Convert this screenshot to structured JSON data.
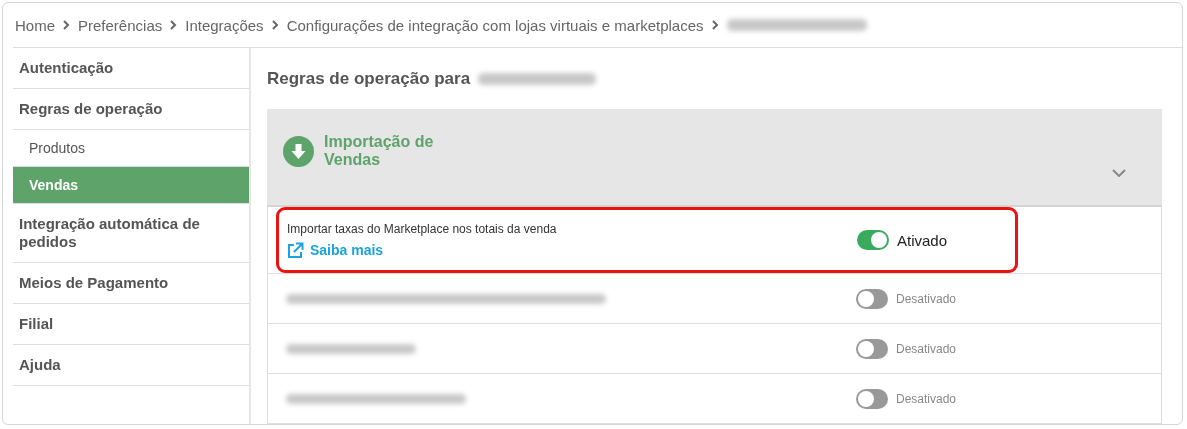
{
  "breadcrumb": {
    "items": [
      "Home",
      "Preferências",
      "Integrações",
      "Configurações de integração com lojas virtuais e marketplaces"
    ],
    "tail_redacted": true
  },
  "sidebar": {
    "items": [
      {
        "label": "Autenticação",
        "sub": false,
        "selected": false
      },
      {
        "label": "Regras de operação",
        "sub": false,
        "selected": false
      },
      {
        "label": "Produtos",
        "sub": true,
        "selected": false
      },
      {
        "label": "Vendas",
        "sub": true,
        "selected": true
      },
      {
        "label": "Integração automática de pedidos",
        "sub": false,
        "selected": false
      },
      {
        "label": "Meios de Pagamento",
        "sub": false,
        "selected": false
      },
      {
        "label": "Filial",
        "sub": false,
        "selected": false
      },
      {
        "label": "Ajuda",
        "sub": false,
        "selected": false
      }
    ]
  },
  "title": {
    "text": "Regras de operação para",
    "name_redacted": true
  },
  "section": {
    "title": "Importação de\nVendas",
    "expanded": true
  },
  "rows": [
    {
      "label": "Importar taxas do Marketplace nos totais da venda",
      "redacted": false,
      "link": "Saiba mais",
      "on": true,
      "status": "Ativado",
      "highlighted": true
    },
    {
      "redacted": true,
      "on": false,
      "status": "Desativado",
      "highlighted": false
    },
    {
      "redacted": true,
      "on": false,
      "status": "Desativado",
      "highlighted": false
    },
    {
      "redacted": true,
      "on": false,
      "status": "Desativado",
      "highlighted": false
    }
  ]
}
